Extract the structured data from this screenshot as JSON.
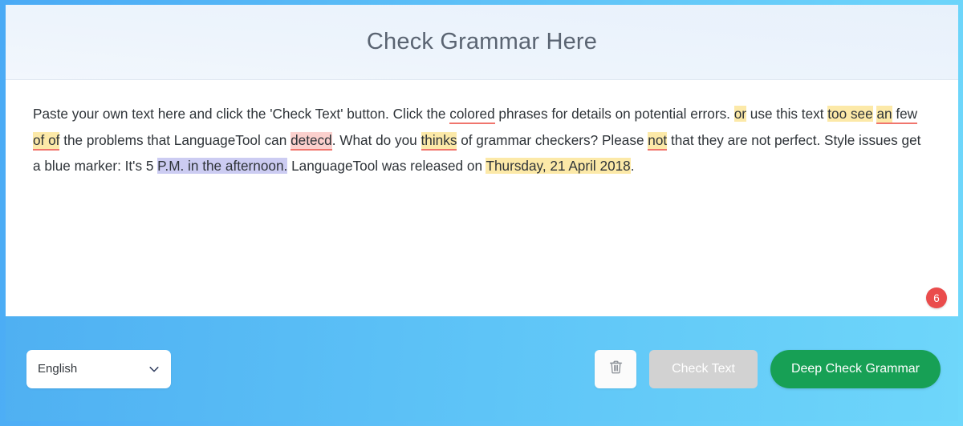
{
  "colors": {
    "frame_blue": "#4aaaf5",
    "frame_cyan": "#6fd8fb",
    "header_bg": "#edf4fc",
    "title_text": "#5a6472",
    "marker_yellow": "#fce9a8",
    "marker_red_underline": "#f0756d",
    "marker_red_bg": "#fbd0cd",
    "marker_blue": "#ccccf2",
    "badge_red": "#ea4c4c",
    "deep_green": "#17a055",
    "disabled_grey": "#d2d2d2"
  },
  "header": {
    "title": "Check Grammar Here"
  },
  "editor": {
    "error_count": "6",
    "segments": [
      {
        "text": "Paste your own text here and click the 'Check Text' button. Click the ",
        "marker": "none"
      },
      {
        "text": "colored",
        "marker": "red-underline"
      },
      {
        "text": " phrases for details on potential errors. ",
        "marker": "none"
      },
      {
        "text": "or",
        "marker": "yellow"
      },
      {
        "text": " use this text ",
        "marker": "none"
      },
      {
        "text": "too see",
        "marker": "yellow"
      },
      {
        "text": " ",
        "marker": "none"
      },
      {
        "text": "an",
        "marker": "yellow-underline"
      },
      {
        "text": " few",
        "marker": "red-underline"
      },
      {
        "text": " ",
        "marker": "none"
      },
      {
        "text": "of of",
        "marker": "yellow-underline"
      },
      {
        "text": " the problems that LanguageTool can ",
        "marker": "none"
      },
      {
        "text": "detecd",
        "marker": "red-bg"
      },
      {
        "text": ". What do you ",
        "marker": "none"
      },
      {
        "text": "thinks",
        "marker": "yellow-underline"
      },
      {
        "text": " of grammar checkers? Please ",
        "marker": "none"
      },
      {
        "text": "not",
        "marker": "yellow-underline"
      },
      {
        "text": " that they are not perfect. Style issues get a blue marker: It's 5 ",
        "marker": "none"
      },
      {
        "text": "P.M. in the afternoon.",
        "marker": "blue"
      },
      {
        "text": " LanguageTool was released on ",
        "marker": "none"
      },
      {
        "text": "Thursday, 21 April 2018",
        "marker": "yellow"
      },
      {
        "text": ".",
        "marker": "none"
      }
    ]
  },
  "toolbar": {
    "language_value": "English",
    "language_options": [
      "English"
    ],
    "chevron_icon": "chevron-down-icon",
    "trash_icon": "trash-icon",
    "check_text_label": "Check Text",
    "deep_check_label": "Deep Check Grammar"
  }
}
